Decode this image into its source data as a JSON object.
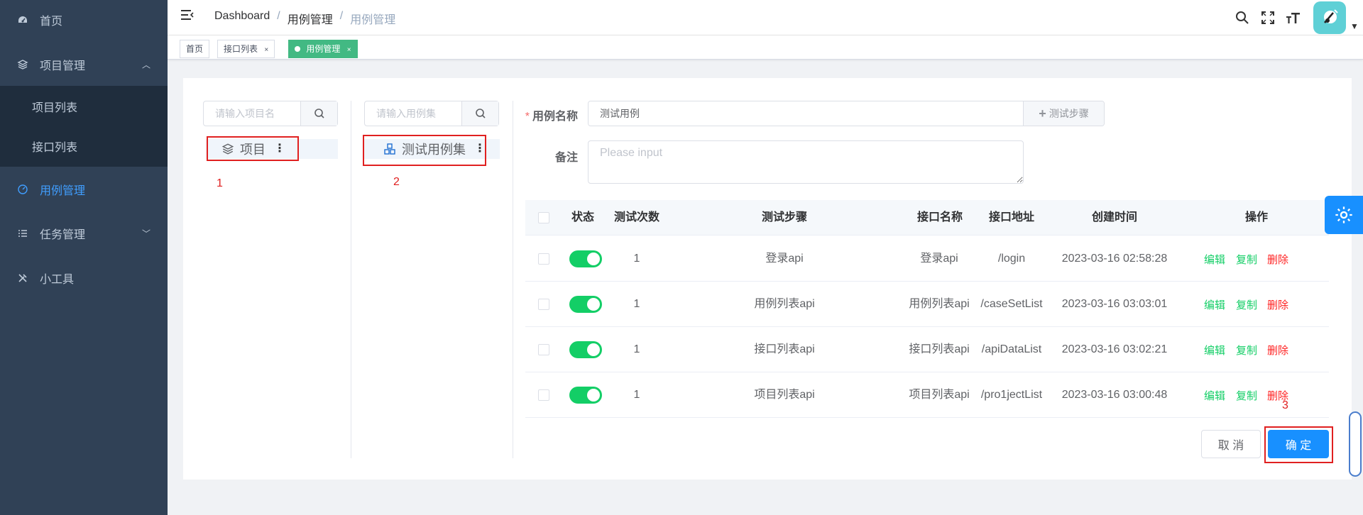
{
  "sidebar": {
    "items": [
      {
        "label": "首页",
        "icon": "dashboard-icon"
      },
      {
        "label": "项目管理",
        "icon": "layers-icon"
      },
      {
        "label": "用例管理",
        "icon": "gauge-icon"
      },
      {
        "label": "任务管理",
        "icon": "list-icon"
      },
      {
        "label": "小工具",
        "icon": "tools-icon"
      }
    ],
    "subitems": [
      {
        "label": "项目列表"
      },
      {
        "label": "接口列表"
      }
    ]
  },
  "header": {
    "breadcrumb": [
      "Dashboard",
      "用例管理",
      "用例管理"
    ],
    "separator": "/"
  },
  "tags": [
    {
      "label": "首页",
      "close": ""
    },
    {
      "label": "接口列表",
      "close": "×"
    },
    {
      "label": "用例管理",
      "close": "×"
    }
  ],
  "left_panel": {
    "search_placeholder": "请输入项目名",
    "tree_label": "项目",
    "marker": "1"
  },
  "mid_panel": {
    "search_placeholder": "请输入用例集",
    "tree_label": "测试用例集",
    "marker": "2"
  },
  "form": {
    "name_label": "用例名称",
    "required_mark": "*",
    "name_value": "测试用例",
    "add_step_label": "测试步骤",
    "remark_label": "备注",
    "remark_placeholder": "Please input"
  },
  "table": {
    "columns": [
      "状态",
      "测试次数",
      "测试步骤",
      "接口名称",
      "接口地址",
      "创建时间",
      "操作"
    ],
    "rows": [
      {
        "count": "1",
        "step": "登录api",
        "api_name": "登录api",
        "api_url": "/login",
        "created": "2023-03-16 02:58:28"
      },
      {
        "count": "1",
        "step": "用例列表api",
        "api_name": "用例列表api",
        "api_url": "/caseSetList",
        "created": "2023-03-16 03:03:01"
      },
      {
        "count": "1",
        "step": "接口列表api",
        "api_name": "接口列表api",
        "api_url": "/apiDataList",
        "created": "2023-03-16 03:02:21"
      },
      {
        "count": "1",
        "step": "项目列表api",
        "api_name": "项目列表api",
        "api_url": "/pro1jectList",
        "created": "2023-03-16 03:00:48"
      }
    ],
    "actions": {
      "edit": "编辑",
      "copy": "复制",
      "delete": "删除"
    }
  },
  "footer": {
    "cancel": "取 消",
    "confirm": "确 定",
    "marker": "3"
  },
  "colors": {
    "sidebar_bg": "#304156",
    "accent": "#409eff",
    "success": "#13ce66",
    "danger": "#ff2222",
    "tag_active": "#42b983",
    "highlight_box": "#e02020"
  }
}
